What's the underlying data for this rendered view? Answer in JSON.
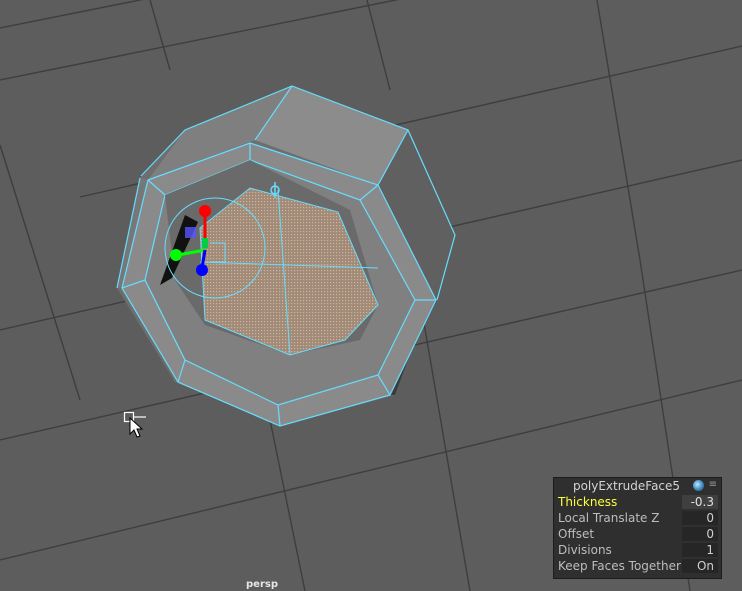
{
  "viewport": {
    "camera_name": "persp",
    "selection_color": "#66ddff",
    "grid_color": "#3e3e3e",
    "background_color": "#5d5d5d"
  },
  "in_view_editor": {
    "node_name": "polyExtrudeFace5",
    "title_icon": "globe-icon",
    "menu_icon": "menu-icon",
    "attributes": [
      {
        "label": "Thickness",
        "value": "-0.3",
        "highlighted": true
      },
      {
        "label": "Local Translate Z",
        "value": "0",
        "highlighted": false
      },
      {
        "label": "Offset",
        "value": "0",
        "highlighted": false
      },
      {
        "label": "Divisions",
        "value": "1",
        "highlighted": false
      },
      {
        "label": "Keep Faces Together",
        "value": "On",
        "highlighted": false
      }
    ]
  },
  "manipulator": {
    "x_axis_color": "#ff0000",
    "y_axis_color": "#00ff00",
    "z_axis_color": "#0000ff"
  },
  "cursor": {
    "icon": "move-cursor-icon"
  }
}
